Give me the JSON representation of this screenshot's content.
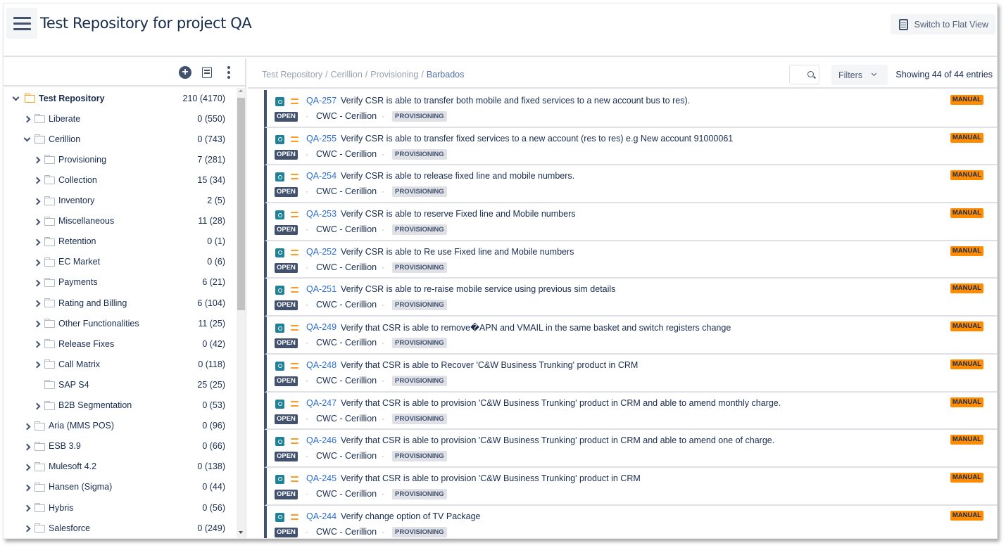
{
  "header": {
    "title": "Test Repository for project QA",
    "switch_view_label": "Switch to Flat View"
  },
  "tree_toolbar": {
    "add_icon": "plus-circle-icon",
    "docs_icon": "documents-icon",
    "more_icon": "more-vertical-icon"
  },
  "tree": [
    {
      "label": "Test Repository",
      "count": "210 (4170)",
      "level": 0,
      "expanded": true,
      "has_children": true,
      "root": true
    },
    {
      "label": "Liberate",
      "count": "0 (550)",
      "level": 1,
      "expanded": false,
      "has_children": true
    },
    {
      "label": "Cerillion",
      "count": "0 (743)",
      "level": 1,
      "expanded": true,
      "has_children": true
    },
    {
      "label": "Provisioning",
      "count": "7 (281)",
      "level": 2,
      "expanded": false,
      "has_children": true
    },
    {
      "label": "Collection",
      "count": "15 (34)",
      "level": 2,
      "expanded": false,
      "has_children": true
    },
    {
      "label": "Inventory",
      "count": "2 (5)",
      "level": 2,
      "expanded": false,
      "has_children": true
    },
    {
      "label": "Miscellaneous",
      "count": "11 (28)",
      "level": 2,
      "expanded": false,
      "has_children": true
    },
    {
      "label": "Retention",
      "count": "0 (1)",
      "level": 2,
      "expanded": false,
      "has_children": true
    },
    {
      "label": "EC Market",
      "count": "0 (6)",
      "level": 2,
      "expanded": false,
      "has_children": true
    },
    {
      "label": "Payments",
      "count": "6 (21)",
      "level": 2,
      "expanded": false,
      "has_children": true
    },
    {
      "label": "Rating and Billing",
      "count": "6 (104)",
      "level": 2,
      "expanded": false,
      "has_children": true
    },
    {
      "label": "Other Functionalities",
      "count": "11 (25)",
      "level": 2,
      "expanded": false,
      "has_children": true
    },
    {
      "label": "Release Fixes",
      "count": "0 (42)",
      "level": 2,
      "expanded": false,
      "has_children": true
    },
    {
      "label": "Call Matrix",
      "count": "0 (118)",
      "level": 2,
      "expanded": false,
      "has_children": true
    },
    {
      "label": "SAP S4",
      "count": "25 (25)",
      "level": 2,
      "expanded": false,
      "has_children": false
    },
    {
      "label": "B2B Segmentation",
      "count": "0 (53)",
      "level": 2,
      "expanded": false,
      "has_children": true
    },
    {
      "label": "Aria (MMS POS)",
      "count": "0 (96)",
      "level": 1,
      "expanded": false,
      "has_children": true
    },
    {
      "label": "ESB 3.9",
      "count": "0 (66)",
      "level": 1,
      "expanded": false,
      "has_children": true
    },
    {
      "label": "Mulesoft 4.2",
      "count": "0 (138)",
      "level": 1,
      "expanded": false,
      "has_children": true
    },
    {
      "label": "Hansen (Sigma)",
      "count": "0 (44)",
      "level": 1,
      "expanded": false,
      "has_children": true
    },
    {
      "label": "Hybris",
      "count": "0 (56)",
      "level": 1,
      "expanded": false,
      "has_children": true
    },
    {
      "label": "Salesforce",
      "count": "0 (249)",
      "level": 1,
      "expanded": false,
      "has_children": true
    }
  ],
  "breadcrumb": [
    "Test Repository",
    "Cerillion",
    "Provisioning",
    "Barbados"
  ],
  "toolbar": {
    "filters_label": "Filters",
    "showing_text": "Showing 44 of 44 entries"
  },
  "colors": {
    "accent_link": "#2d6fcf",
    "status_bg": "#42526e",
    "manual_badge": "#ff8b00",
    "priority": "#ff991f",
    "type_icon": "#1f8296"
  },
  "issues": [
    {
      "key": "QA-257",
      "summary": "Verify CSR is able to transfer both mobile and fixed services to a new account bus to res).",
      "status": "OPEN",
      "component": "CWC - Cerillion",
      "label": "PROVISIONING",
      "test_type": "MANUAL"
    },
    {
      "key": "QA-255",
      "summary": "Verify CSR is able to transfer fixed services to a new account (res to res) e.g New account 91000061",
      "status": "OPEN",
      "component": "CWC - Cerillion",
      "label": "PROVISIONING",
      "test_type": "MANUAL"
    },
    {
      "key": "QA-254",
      "summary": "Verify CSR is able to release fixed line and mobile numbers.",
      "status": "OPEN",
      "component": "CWC - Cerillion",
      "label": "PROVISIONING",
      "test_type": "MANUAL"
    },
    {
      "key": "QA-253",
      "summary": "Verify CSR is able to reserve Fixed line and Mobile numbers",
      "status": "OPEN",
      "component": "CWC - Cerillion",
      "label": "PROVISIONING",
      "test_type": "MANUAL"
    },
    {
      "key": "QA-252",
      "summary": "Verify CSR is able to Re use Fixed line and Mobile numbers",
      "status": "OPEN",
      "component": "CWC - Cerillion",
      "label": "PROVISIONING",
      "test_type": "MANUAL"
    },
    {
      "key": "QA-251",
      "summary": "Verify CSR is able to re-raise mobile service using previous sim details",
      "status": "OPEN",
      "component": "CWC - Cerillion",
      "label": "PROVISIONING",
      "test_type": "MANUAL"
    },
    {
      "key": "QA-249",
      "summary": "Verify that CSR is able to remove�APN and VMAIL in the same basket and switch registers change",
      "status": "OPEN",
      "component": "CWC - Cerillion",
      "label": "PROVISIONING",
      "test_type": "MANUAL"
    },
    {
      "key": "QA-248",
      "summary": "Verify that CSR is able to Recover 'C&W Business Trunking' product in CRM",
      "status": "OPEN",
      "component": "CWC - Cerillion",
      "label": "PROVISIONING",
      "test_type": "MANUAL"
    },
    {
      "key": "QA-247",
      "summary": "Verify that CSR is able to provision 'C&W Business Trunking' product in CRM and able to amend monthly charge.",
      "status": "OPEN",
      "component": "CWC - Cerillion",
      "label": "PROVISIONING",
      "test_type": "MANUAL"
    },
    {
      "key": "QA-246",
      "summary": "Verify that CSR is able to provision 'C&W Business Trunking' product in CRM and able to amend one of charge.",
      "status": "OPEN",
      "component": "CWC - Cerillion",
      "label": "PROVISIONING",
      "test_type": "MANUAL"
    },
    {
      "key": "QA-245",
      "summary": "Verify that CSR is able to provision 'C&W Business Trunking' product in CRM",
      "status": "OPEN",
      "component": "CWC - Cerillion",
      "label": "PROVISIONING",
      "test_type": "MANUAL"
    },
    {
      "key": "QA-244",
      "summary": "Verify change option of TV Package",
      "status": "OPEN",
      "component": "CWC - Cerillion",
      "label": "PROVISIONING",
      "test_type": "MANUAL"
    }
  ]
}
